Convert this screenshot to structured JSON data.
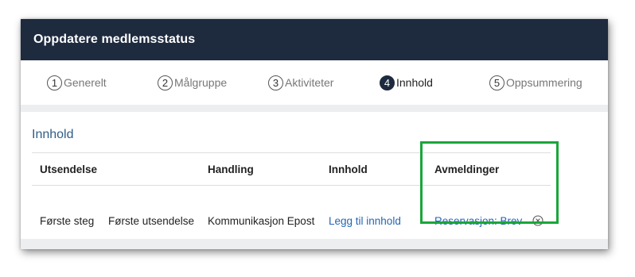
{
  "dialog": {
    "title": "Oppdatere medlemsstatus"
  },
  "steps": [
    {
      "num": "1",
      "label": "Generelt"
    },
    {
      "num": "2",
      "label": "Målgruppe"
    },
    {
      "num": "3",
      "label": "Aktiviteter"
    },
    {
      "num": "4",
      "label": "Innhold",
      "active": true
    },
    {
      "num": "5",
      "label": "Oppsummering"
    }
  ],
  "content": {
    "section_title": "Innhold",
    "columns": [
      "Utsendelse",
      "Handling",
      "Innhold",
      "Avmeldinger"
    ],
    "rows": [
      {
        "step": "Første steg",
        "utsendelse": "Første utsendelse",
        "handling": "Kommunikasjon Epost",
        "innhold": "Legg til innhold",
        "avmelding": "Reservasjon: Brev"
      }
    ]
  },
  "icons": {
    "remove": "circle-x-icon"
  },
  "colors": {
    "header_bg": "#1e2a3e",
    "link": "#2466b3",
    "section_title": "#2f5d88",
    "highlight": "#1aa63a"
  }
}
